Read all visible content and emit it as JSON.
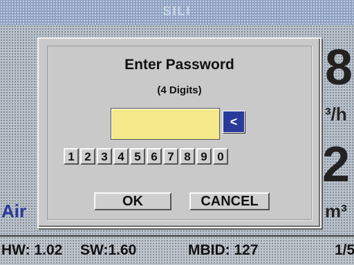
{
  "background": {
    "title": "SILI",
    "value_top": "8",
    "unit_top": "³/h",
    "value_bottom": "2",
    "unit_bottom": "m³",
    "left_label": "Air"
  },
  "status_bar": {
    "hw": "HW: 1.02",
    "sw": "SW:1.60",
    "mbid": "MBID: 127",
    "page": "1/5"
  },
  "dialog": {
    "title": "Enter Password",
    "subtitle": "(4 Digits)",
    "password_value": "",
    "backspace_label": "<",
    "digits": [
      "1",
      "2",
      "3",
      "4",
      "5",
      "6",
      "7",
      "8",
      "9",
      "0"
    ],
    "ok_label": "OK",
    "cancel_label": "CANCEL"
  },
  "colors": {
    "field_bg": "#f4ea8c",
    "backspace_bg": "#2a3a9a",
    "title_bar": "#8ea2c4",
    "accent_text": "#2b3a9c"
  }
}
